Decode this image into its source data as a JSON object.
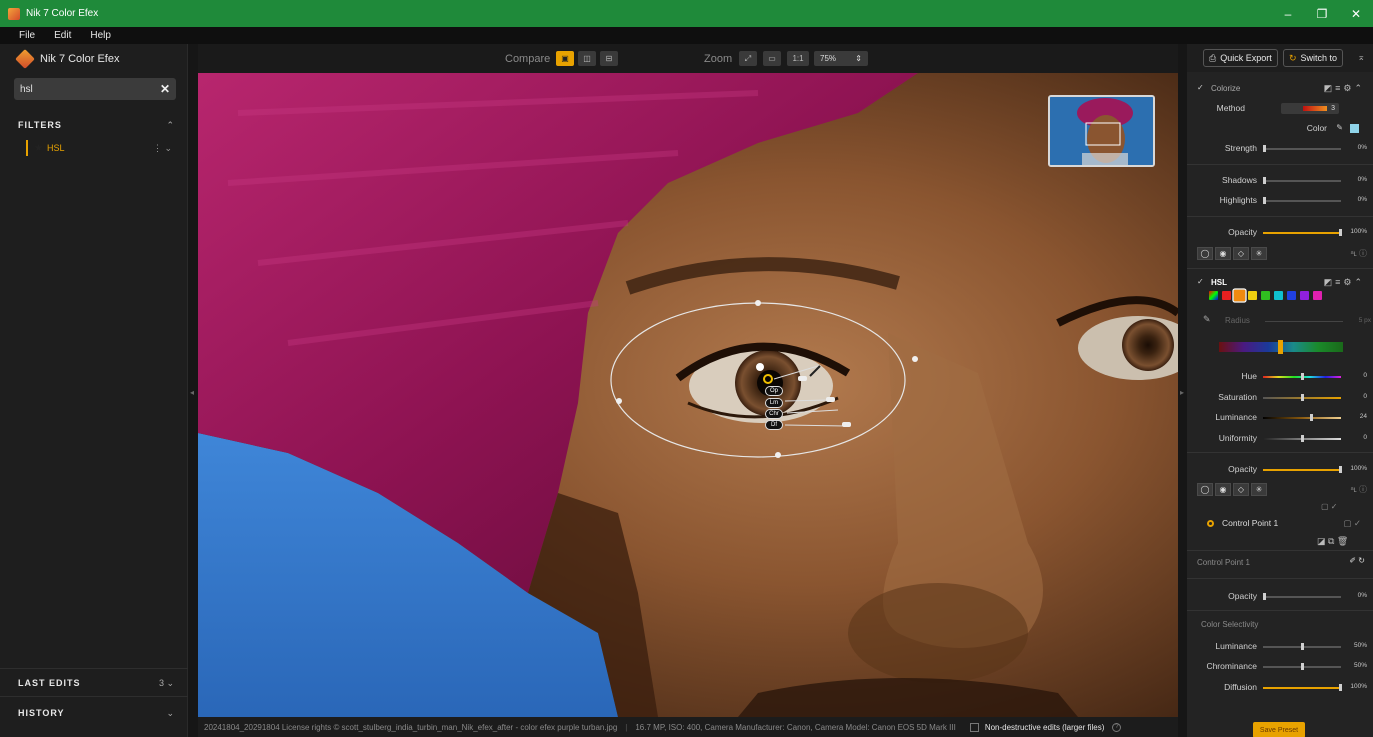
{
  "window": {
    "title": "Nik 7 Color Efex",
    "controls": [
      "–",
      "❐",
      "✕"
    ]
  },
  "menu": [
    "File",
    "Edit",
    "Help"
  ],
  "sidebar": {
    "app_name": "Nik 7 Color Efex",
    "search": {
      "value": "hsl"
    },
    "filters_heading": "FILTERS",
    "filter_item": "HSL",
    "last_edits_heading": "LAST EDITS",
    "last_edits_count": "3",
    "history_heading": "HISTORY"
  },
  "toolbar": {
    "compare_label": "Compare",
    "zoom_label": "Zoom",
    "zoom_one_to_one": "1:1",
    "zoom_value": "75%"
  },
  "control_point_labels": [
    "Op",
    "Lm",
    "Chr",
    "Df"
  ],
  "statusbar": {
    "filename": "20241804_20291804 License rights © scott_stulberg_india_turbin_man_Nik_efex_after - color efex purple turban.jpg",
    "meta": "16.7 MP, ISO: 400, Camera Manufacturer: Canon, Camera Model: Canon EOS 5D Mark III",
    "non_destructive": "Non-destructive edits (larger files)"
  },
  "right_panel": {
    "quick_export": "Quick Export",
    "switch_to": "Switch to",
    "colorize": {
      "title": "Colorize",
      "method_label": "Method",
      "method_value": "3",
      "color_label": "Color",
      "color_value": "#8fd3e8",
      "strength_label": "Strength",
      "strength_val": "0%",
      "shadows_label": "Shadows",
      "shadows_val": "0%",
      "highlights_label": "Highlights",
      "highlights_val": "0%",
      "opacity_label": "Opacity",
      "opacity_val": "100%"
    },
    "hsl": {
      "title": "HSL",
      "radius_label": "Radius",
      "radius_val": "5 px",
      "hue_label": "Hue",
      "hue_val": "0",
      "saturation_label": "Saturation",
      "saturation_val": "0",
      "luminance_label": "Luminance",
      "luminance_val": "24",
      "uniformity_label": "Uniformity",
      "uniformity_val": "0",
      "opacity_label": "Opacity",
      "opacity_val": "100%",
      "control_point": "Control Point 1"
    },
    "cp_section": {
      "title": "Control Point 1",
      "opacity_label": "Opacity",
      "opacity_val": "0%",
      "color_selectivity": "Color Selectivity",
      "luminance_label": "Luminance",
      "luminance_val": "50%",
      "chrominance_label": "Chrominance",
      "chrominance_val": "50%",
      "diffusion_label": "Diffusion",
      "diffusion_val": "100%"
    },
    "save_preset": "Save Preset"
  },
  "colors": {
    "accent": "#e8a200",
    "titlebar": "#1f8a3a"
  }
}
